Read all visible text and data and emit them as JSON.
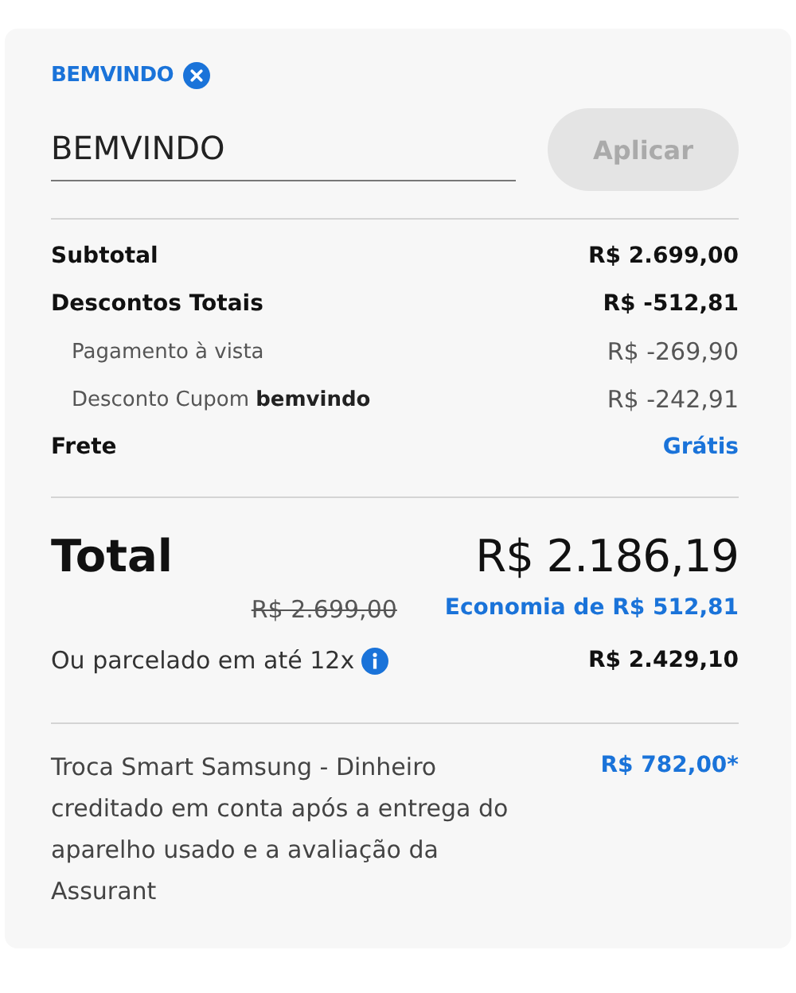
{
  "coupon": {
    "applied_code": "BEMVINDO",
    "input_value": "BEMVINDO",
    "button": {
      "label": "Aplicar",
      "disabled": true
    }
  },
  "summary": [
    {
      "label": "Subtotal",
      "value": "R$ 2.699,00",
      "kind": "main",
      "accent": false
    },
    {
      "label": "Descontos Totais",
      "value": "R$ -512,81",
      "kind": "main",
      "accent": false
    },
    {
      "label": "Pagamento à vista",
      "value": "R$ -269,90",
      "kind": "sub",
      "accent": false
    },
    {
      "label": "Desconto Cupom **bemvindo**",
      "value": "R$ -242,91",
      "kind": "sub",
      "accent": false
    },
    {
      "label": "Frete",
      "value": "Grátis",
      "kind": "main",
      "accent": true
    }
  ],
  "total": {
    "label": "Total",
    "value": "R$ 2.186,19",
    "old_price": "R$ 2.699,00",
    "savings": "Economia de R$ 512,81"
  },
  "installments": {
    "label": "Ou parcelado em até 12x",
    "value": "R$ 2.429,10"
  },
  "trade_in": {
    "text": "Troca Smart Samsung - Dinheiro creditado em conta após a entrega do aparelho usado e a avaliação da Assurant",
    "value": "R$ 782,00*"
  }
}
